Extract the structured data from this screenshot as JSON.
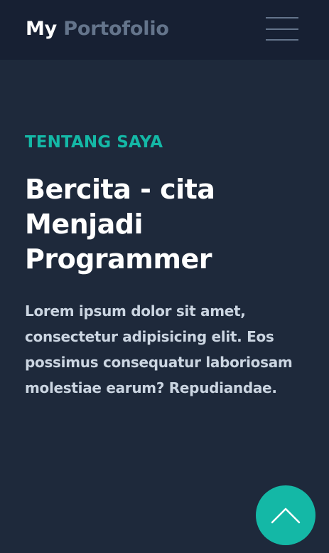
{
  "navbar": {
    "brand_prefix": "My",
    "brand_name": "Portofolio",
    "menu_icon": "hamburger-menu-icon"
  },
  "about": {
    "section_label": "TENTANG SAYA",
    "headline": "Bercita - cita Menjadi Programmer",
    "description": "Lorem ipsum dolor sit amet, consectetur adipisicing elit. Eos possimus consequatur laboriosam molestiae earum? Repudiandae."
  },
  "back_to_top": {
    "icon": "chevron-up-icon"
  },
  "colors": {
    "background": "#1e293b",
    "navbar": "#172033",
    "accent": "#14b8a6",
    "muted": "#64748b",
    "text": "#cbd5e1",
    "heading": "#ffffff"
  }
}
